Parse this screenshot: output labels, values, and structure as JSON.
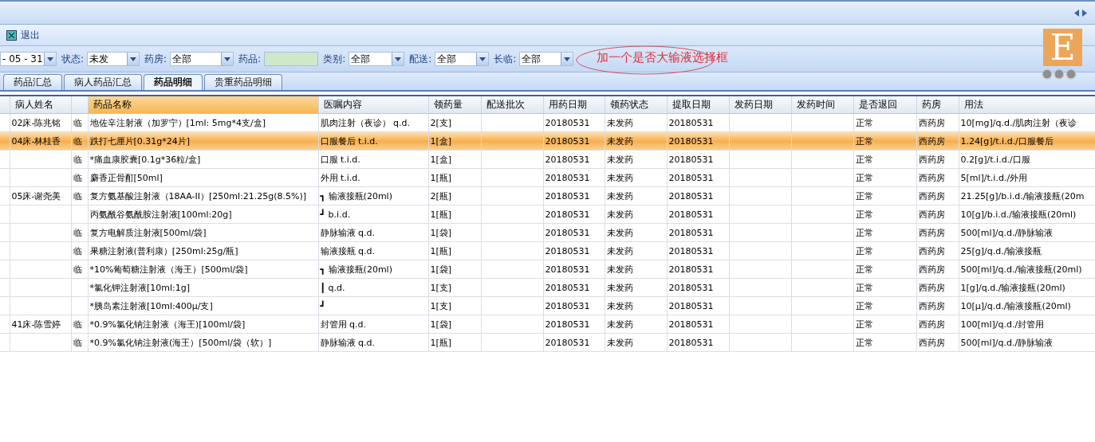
{
  "toolbar": {
    "exit_label": "退出"
  },
  "filters": [
    {
      "kind": "dropdown",
      "value": "- 05 - 31"
    },
    {
      "kind": "dropdown",
      "label": "状态:",
      "value": "未发"
    },
    {
      "kind": "dropdown",
      "label": "药房:",
      "value": "全部"
    },
    {
      "kind": "input",
      "label": "药品:"
    },
    {
      "kind": "dropdown",
      "label": "类别:",
      "value": "全部"
    },
    {
      "kind": "dropdown",
      "label": "配送:",
      "value": "全部"
    },
    {
      "kind": "dropdown",
      "label": "长临:",
      "value": "全部"
    }
  ],
  "annotation": "加一个是否大输液选择框",
  "logo": {
    "letter": "E"
  },
  "tabs": [
    {
      "label": "药品汇总",
      "selected": false
    },
    {
      "label": "病人药品汇总",
      "selected": false
    },
    {
      "label": "药品明细",
      "selected": true
    },
    {
      "label": "贵重药品明细",
      "selected": false
    }
  ],
  "table": {
    "columns": [
      {
        "label": "病人姓名",
        "sorted": false
      },
      {
        "sorted": false
      },
      {
        "label": "药品名称",
        "sorted": true
      },
      {
        "label": "医嘱内容",
        "sorted": false
      },
      {
        "label": "领药量",
        "sorted": false
      },
      {
        "label": "配送批次",
        "sorted": false
      },
      {
        "label": "用药日期",
        "sorted": false
      },
      {
        "label": "领药状态",
        "sorted": false
      },
      {
        "label": "提取日期",
        "sorted": false
      },
      {
        "label": "发药日期",
        "sorted": false
      },
      {
        "label": "发药时间",
        "sorted": false
      },
      {
        "label": "是否退回",
        "sorted": false
      },
      {
        "label": "药房",
        "sorted": false
      },
      {
        "label": "用法",
        "sorted": false
      }
    ],
    "rows": [
      {
        "selected": false,
        "patient": "02床-陈兆铭",
        "flag": "临",
        "drug": "地佐辛注射液（加罗宁）[1ml: 5mg*4支/盒]",
        "order": "肌肉注射（夜诊） q.d.",
        "qty": "2[支]",
        "use_date": "20180531",
        "status": "未发药",
        "fetch_date": "20180531",
        "returned": "正常",
        "pharmacy": "西药房",
        "usage": "10[mg]/q.d./肌肉注射（夜诊"
      },
      {
        "selected": true,
        "patient": "04床-林桂香",
        "flag": "临",
        "drug": "跌打七厘片[0.31g*24片]",
        "order": "口服餐后 t.i.d.",
        "qty": "1[盒]",
        "use_date": "20180531",
        "status": "未发药",
        "fetch_date": "20180531",
        "returned": "正常",
        "pharmacy": "西药房",
        "usage": "1.24[g]/t.i.d./口服餐后"
      },
      {
        "selected": false,
        "flag": "临",
        "drug": "*痛血康胶囊[0.1g*36粒/盒]",
        "order": "口服 t.i.d.",
        "qty": "1[盒]",
        "use_date": "20180531",
        "status": "未发药",
        "fetch_date": "20180531",
        "returned": "正常",
        "pharmacy": "西药房",
        "usage": "0.2[g]/t.i.d./口服"
      },
      {
        "selected": false,
        "flag": "临",
        "drug": "麝香正骨酊[50ml]",
        "order": "外用 t.i.d.",
        "qty": "1[瓶]",
        "use_date": "20180531",
        "status": "未发药",
        "fetch_date": "20180531",
        "returned": "正常",
        "pharmacy": "西药房",
        "usage": "5[ml]/t.i.d./外用"
      },
      {
        "selected": false,
        "patient": "05床-谢尧美",
        "flag": "临",
        "drug": "复方氨基酸注射液（18AA-II）[250ml:21.25g(8.5%)]",
        "order": "┓ 输液接瓶(20ml)",
        "qty": "2[瓶]",
        "use_date": "20180531",
        "status": "未发药",
        "fetch_date": "20180531",
        "returned": "正常",
        "pharmacy": "西药房",
        "usage": "21.25[g]/b.i.d./输液接瓶(20m"
      },
      {
        "selected": false,
        "drug": "丙氨酰谷氨酰胺注射液[100ml:20g]",
        "order": "┛ b.i.d.",
        "qty": "1[瓶]",
        "use_date": "20180531",
        "status": "未发药",
        "fetch_date": "20180531",
        "returned": "正常",
        "pharmacy": "西药房",
        "usage": "10[g]/b.i.d./输液接瓶(20ml)"
      },
      {
        "selected": false,
        "flag": "临",
        "drug": "复方电解质注射液[500ml/袋]",
        "order": "静脉输液 q.d.",
        "qty": "1[袋]",
        "use_date": "20180531",
        "status": "未发药",
        "fetch_date": "20180531",
        "returned": "正常",
        "pharmacy": "西药房",
        "usage": "500[ml]/q.d./静脉输液"
      },
      {
        "selected": false,
        "flag": "临",
        "drug": "果糖注射液(普利康）[250ml:25g/瓶]",
        "order": "输液接瓶 q.d.",
        "qty": "1[瓶]",
        "use_date": "20180531",
        "status": "未发药",
        "fetch_date": "20180531",
        "returned": "正常",
        "pharmacy": "西药房",
        "usage": "25[g]/q.d./输液接瓶"
      },
      {
        "selected": false,
        "flag": "临",
        "drug": "*10%葡萄糖注射液（海王）[500ml/袋]",
        "order": "┓ 输液接瓶(20ml)",
        "qty": "1[袋]",
        "use_date": "20180531",
        "status": "未发药",
        "fetch_date": "20180531",
        "returned": "正常",
        "pharmacy": "西药房",
        "usage": "500[ml]/q.d./输液接瓶(20ml)"
      },
      {
        "selected": false,
        "drug": "*氯化钾注射液[10ml:1g]",
        "order": "┃ q.d.",
        "qty": "1[支]",
        "use_date": "20180531",
        "status": "未发药",
        "fetch_date": "20180531",
        "returned": "正常",
        "pharmacy": "西药房",
        "usage": "1[g]/q.d./输液接瓶(20ml)"
      },
      {
        "selected": false,
        "drug": "*胰岛素注射液[10ml:400μ/支]",
        "order": "┛",
        "qty": "1[支]",
        "use_date": "20180531",
        "status": "未发药",
        "fetch_date": "20180531",
        "returned": "正常",
        "pharmacy": "西药房",
        "usage": "10[μ]/q.d./输液接瓶(20ml)"
      },
      {
        "selected": false,
        "patient": "41床-陈雪婷",
        "flag": "临",
        "drug": "*0.9%氯化钠注射液（海王)[100ml/袋]",
        "order": "封管用 q.d.",
        "qty": "1[袋]",
        "use_date": "20180531",
        "status": "未发药",
        "fetch_date": "20180531",
        "returned": "正常",
        "pharmacy": "西药房",
        "usage": "100[ml]/q.d./封管用"
      },
      {
        "selected": false,
        "flag": "临",
        "drug": "*0.9%氯化钠注射液(海王）[500ml/袋（软）]",
        "order": "静脉输液 q.d.",
        "qty": "1[瓶]",
        "use_date": "20180531",
        "status": "未发药",
        "fetch_date": "20180531",
        "returned": "正常",
        "pharmacy": "西药房",
        "usage": "500[ml]/q.d./静脉输液"
      }
    ]
  }
}
